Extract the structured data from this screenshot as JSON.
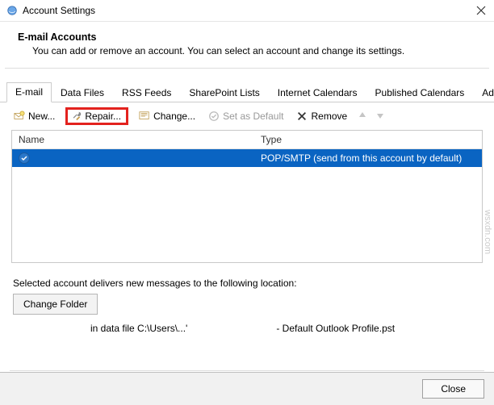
{
  "window": {
    "title": "Account Settings",
    "close_tooltip": "Close"
  },
  "header": {
    "title": "E-mail Accounts",
    "description": "You can add or remove an account. You can select an account and change its settings."
  },
  "tabs": [
    {
      "label": "E-mail",
      "active": true
    },
    {
      "label": "Data Files",
      "active": false
    },
    {
      "label": "RSS Feeds",
      "active": false
    },
    {
      "label": "SharePoint Lists",
      "active": false
    },
    {
      "label": "Internet Calendars",
      "active": false
    },
    {
      "label": "Published Calendars",
      "active": false
    },
    {
      "label": "Address Books",
      "active": false
    }
  ],
  "toolbar": {
    "new_label": "New...",
    "repair_label": "Repair...",
    "change_label": "Change...",
    "set_default_label": "Set as Default",
    "remove_label": "Remove"
  },
  "list": {
    "columns": {
      "name": "Name",
      "type": "Type"
    },
    "rows": [
      {
        "name": "",
        "type": "POP/SMTP (send from this account by default)",
        "selected": true,
        "default": true
      }
    ]
  },
  "delivery": {
    "text": "Selected account delivers new messages to the following location:",
    "change_folder_label": "Change Folder",
    "path_left": "in data file C:\\Users\\...'",
    "path_right": "- Default Outlook Profile.pst"
  },
  "footer": {
    "close_label": "Close"
  },
  "watermark": "wsxdn.com"
}
